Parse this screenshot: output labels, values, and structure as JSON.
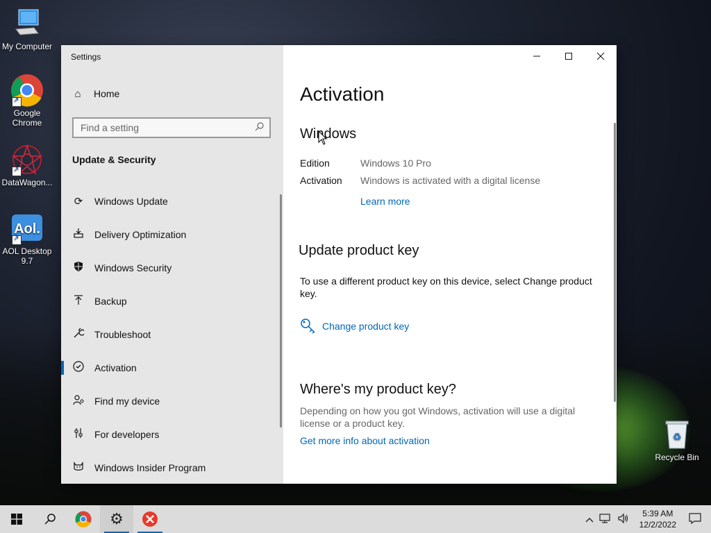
{
  "desktop": {
    "icons": [
      {
        "label": "My Computer"
      },
      {
        "label": "Google Chrome"
      },
      {
        "label": "DataWagon..."
      },
      {
        "label": "AOL Desktop 9.7"
      },
      {
        "label": "Recycle Bin"
      }
    ]
  },
  "window": {
    "title": "Settings",
    "controls": {
      "minimize": "—",
      "maximize": "☐",
      "close": "✕"
    }
  },
  "sidebar": {
    "home_label": "Home",
    "search_placeholder": "Find a setting",
    "section_title": "Update & Security",
    "items": [
      {
        "label": "Windows Update",
        "icon": "refresh-icon"
      },
      {
        "label": "Delivery Optimization",
        "icon": "delivery-icon"
      },
      {
        "label": "Windows Security",
        "icon": "shield-icon"
      },
      {
        "label": "Backup",
        "icon": "backup-arrow-icon"
      },
      {
        "label": "Troubleshoot",
        "icon": "wrench-icon"
      },
      {
        "label": "Activation",
        "icon": "check-circle-icon",
        "active": true
      },
      {
        "label": "Find my device",
        "icon": "person-location-icon"
      },
      {
        "label": "For developers",
        "icon": "developer-sliders-icon"
      },
      {
        "label": "Windows Insider Program",
        "icon": "insider-cat-icon"
      }
    ]
  },
  "main": {
    "page_title": "Activation",
    "windows_heading": "Windows",
    "edition_label": "Edition",
    "edition_value": "Windows 10 Pro",
    "activation_label": "Activation",
    "activation_value": "Windows is activated with a digital license",
    "learn_more": "Learn more",
    "update_key_heading": "Update product key",
    "update_key_text": "To use a different product key on this device, select Change product key.",
    "change_key_link": "Change product key",
    "where_heading": "Where's my product key?",
    "where_text": "Depending on how you got Windows, activation will use a digital license or a product key.",
    "more_info_link": "Get more info about activation"
  },
  "taskbar": {
    "time": "5:39 AM",
    "date": "12/2/2022"
  },
  "colors": {
    "accent": "#0067b8",
    "sidebar_bg": "#e6e6e6",
    "taskbar_bg": "#dcdcdc"
  }
}
